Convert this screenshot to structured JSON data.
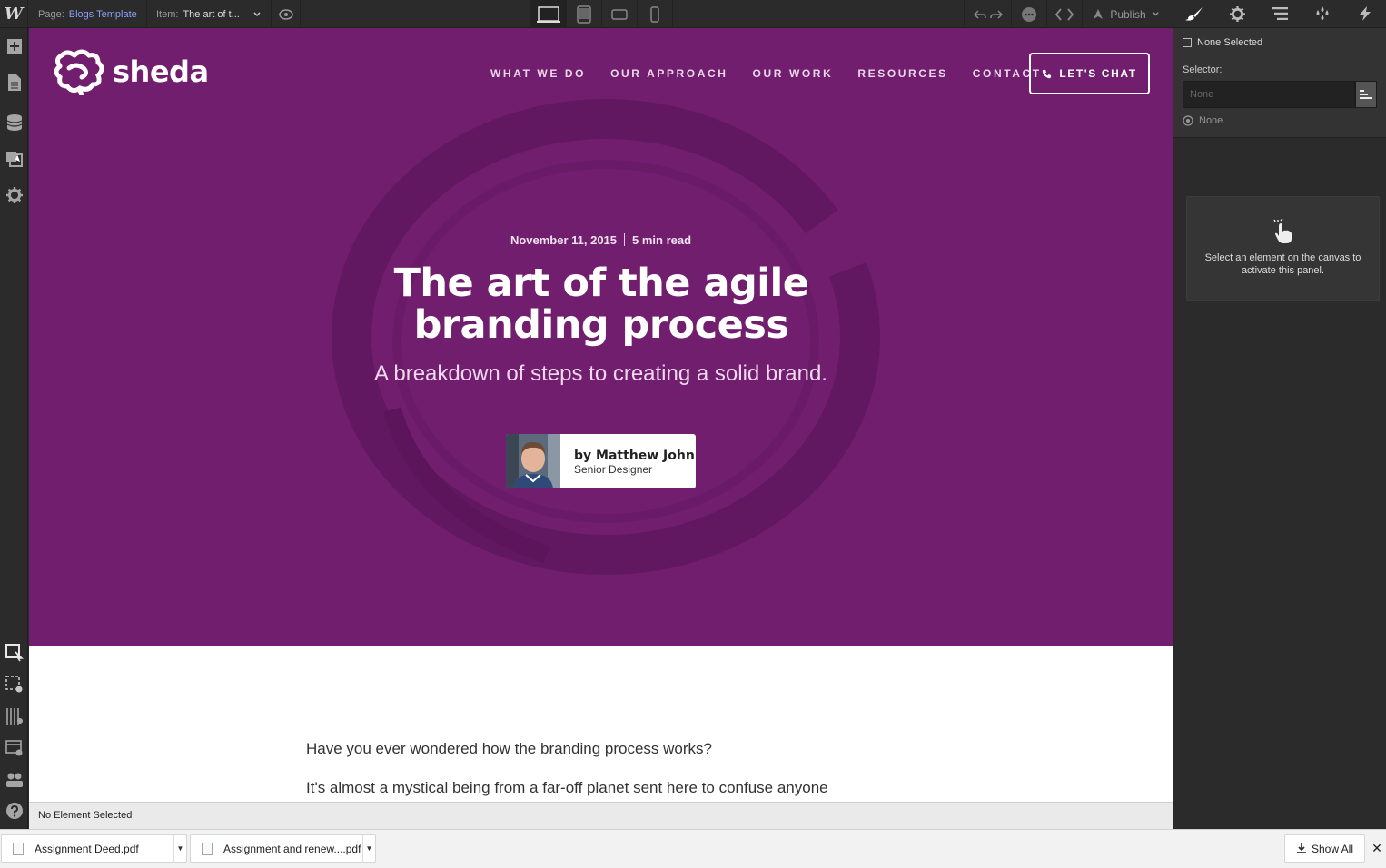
{
  "topbar": {
    "logo": "W",
    "page_label": "Page:",
    "page_value": "Blogs Template",
    "item_label": "Item:",
    "item_value": "The art of t...",
    "devices": [
      "desktop-icon",
      "tablet-icon",
      "mobile-landscape-icon",
      "mobile-portrait-icon"
    ],
    "publish_label": "Publish"
  },
  "leftbar": {
    "top_tools": [
      "add-icon",
      "pages-icon",
      "cms-icon",
      "assets-icon",
      "settings-icon"
    ],
    "bottom_tools": [
      "select-icon",
      "preview-icon",
      "grid-icon",
      "template-icon",
      "team-icon",
      "help-icon"
    ]
  },
  "site": {
    "brand": "sheda",
    "nav": [
      "WHAT WE DO",
      "OUR APPROACH",
      "OUR WORK",
      "RESOURCES",
      "CONTACT"
    ],
    "cta": "LET'S CHAT",
    "date": "November 11, 2015",
    "read_time": "5 min read",
    "title": "The art of the agile branding process",
    "subtitle": "A breakdown of steps to creating a solid brand.",
    "author_name": "by Matthew John",
    "author_role": "Senior Designer",
    "paragraph_1": "Have you ever wondered how the branding process works?",
    "paragraph_2": "It's almost a mystical being from a far-off planet sent here to confuse anyone",
    "hero_bg": "#711e6e"
  },
  "statusbar": {
    "text": "No Element Selected"
  },
  "rightpanel": {
    "tabs": [
      "style-brush-icon",
      "settings-gear-icon",
      "navigator-icon",
      "swatches-icon",
      "interactions-icon"
    ],
    "none_selected": "None Selected",
    "selector_label": "Selector:",
    "selector_placeholder": "None",
    "none_row": "None",
    "hint": "Select an element on the canvas to activate this panel."
  },
  "downloads": {
    "files": [
      "Assignment Deed.pdf",
      "Assignment and renew....pdf"
    ],
    "show_all": "Show All"
  }
}
